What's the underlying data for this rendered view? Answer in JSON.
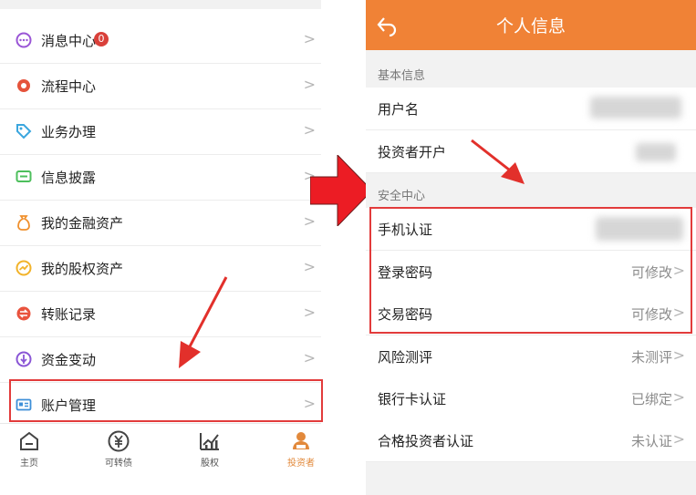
{
  "left": {
    "menu": [
      {
        "label": "消息中心",
        "icon": "message-icon",
        "color": "#9a56d6",
        "badge": "0"
      },
      {
        "label": "流程中心",
        "icon": "process-icon",
        "color": "#e5533b"
      },
      {
        "label": "业务办理",
        "icon": "tag-icon",
        "color": "#3aa6de"
      },
      {
        "label": "信息披露",
        "icon": "info-screen-icon",
        "color": "#4dbf5c"
      },
      {
        "label": "我的金融资产",
        "icon": "money-bag-icon",
        "color": "#f0902d"
      },
      {
        "label": "我的股权资产",
        "icon": "growth-icon",
        "color": "#f2b32a"
      },
      {
        "label": "转账记录",
        "icon": "transfer-icon",
        "color": "#e9533e"
      },
      {
        "label": "资金变动",
        "icon": "fund-change-icon",
        "color": "#8a56d6"
      },
      {
        "label": "账户管理",
        "icon": "id-card-icon",
        "color": "#3d8fd8"
      }
    ],
    "chevron": ">",
    "tabs": [
      {
        "label": "主页",
        "icon": "home-icon"
      },
      {
        "label": "可转债",
        "icon": "yuan-icon"
      },
      {
        "label": "股权",
        "icon": "chart-icon"
      },
      {
        "label": "投资者",
        "icon": "investor-icon"
      }
    ]
  },
  "right": {
    "title": "个人信息",
    "sections": [
      {
        "title": "基本信息"
      },
      {
        "title": "安全中心"
      }
    ],
    "basic_rows": [
      {
        "label": "用户名",
        "value": ""
      },
      {
        "label": "投资者开户",
        "value": ""
      }
    ],
    "security_rows": [
      {
        "label": "手机认证",
        "value": ""
      },
      {
        "label": "登录密码",
        "value": "可修改"
      },
      {
        "label": "交易密码",
        "value": "可修改"
      }
    ],
    "other_rows": [
      {
        "label": "风险测评",
        "value": "未测评"
      },
      {
        "label": "银行卡认证",
        "value": "已绑定"
      },
      {
        "label": "合格投资者认证",
        "value": "未认证"
      }
    ],
    "chevron": ">"
  },
  "colors": {
    "accent": "#f08236",
    "highlight": "#e23b3b"
  }
}
